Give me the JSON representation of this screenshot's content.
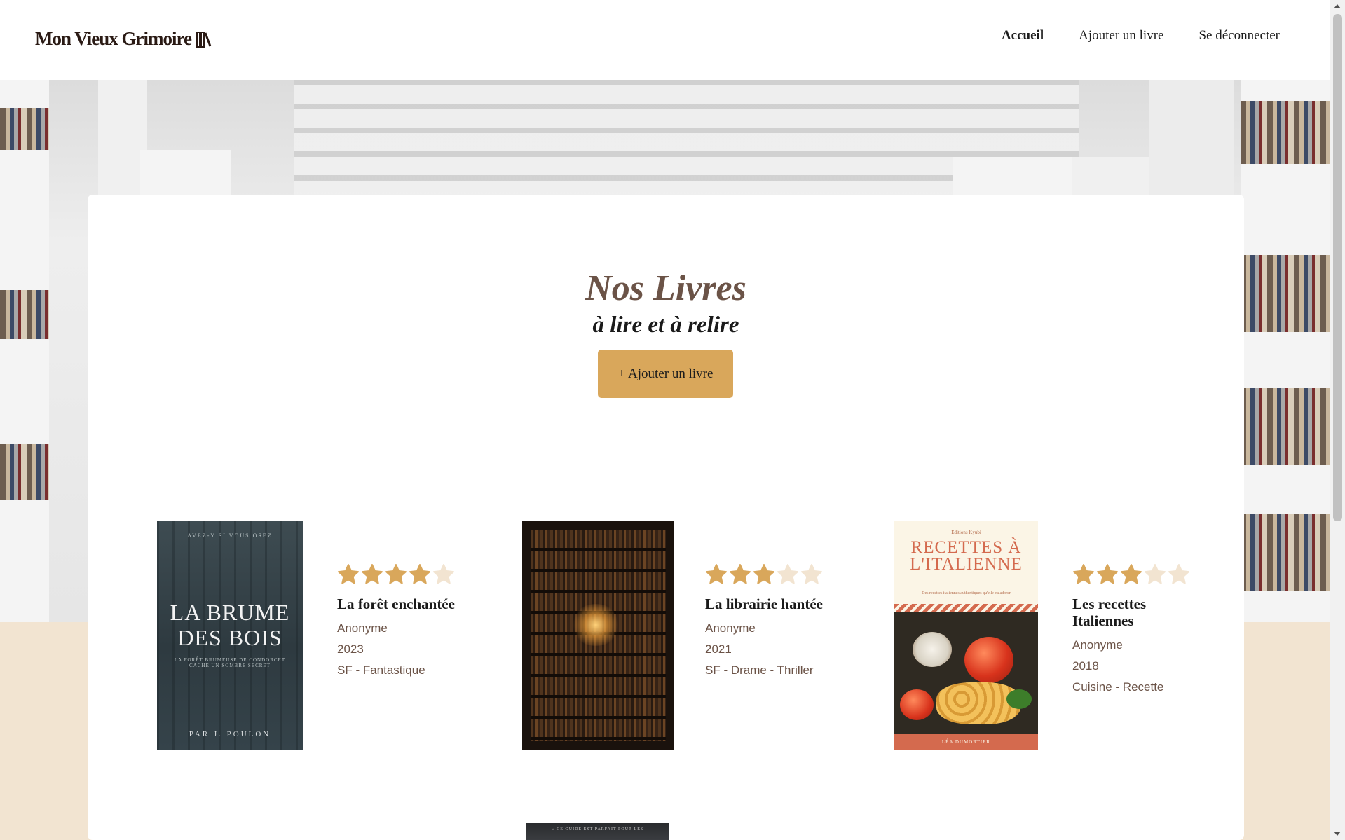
{
  "header": {
    "logo_text": "Mon Vieux Grimoire",
    "logo_icon": "books-icon",
    "nav": [
      {
        "label": "Accueil",
        "active": true
      },
      {
        "label": "Ajouter un livre",
        "active": false
      },
      {
        "label": "Se déconnecter",
        "active": false
      }
    ]
  },
  "main": {
    "title": "Nos Livres",
    "subtitle": "à lire et à relire",
    "add_button_label": "+ Ajouter un livre"
  },
  "books": [
    {
      "title": "La forêt enchantée",
      "author": "Anonyme",
      "year": "2023",
      "genre": "SF - Fantastique",
      "rating": 4,
      "cover": {
        "top": "AVEZ-Y SI VOUS OSEZ",
        "title": "LA BRUME DES BOIS",
        "tagline": "LA FORÊT BRUMEUSE DE CONDORCET CACHE UN SOMBRE SECRET",
        "author": "PAR J. POULON"
      }
    },
    {
      "title": "La librairie hantée",
      "author": "Anonyme",
      "year": "2021",
      "genre": "SF - Drame - Thriller",
      "rating": 3
    },
    {
      "title": "Les recettes Italiennes",
      "author": "Anonyme",
      "year": "2018",
      "genre": "Cuisine - Recette",
      "rating": 3,
      "cover": {
        "publisher": "Editions Kyubi",
        "title": "RECETTES À L'ITALIENNE",
        "tagline": "Des recettes italiennes authentiques qu'elle va adorer",
        "author": "LÉA DUMORTIER"
      }
    }
  ],
  "partial_book": {
    "cover_text": "« CE GUIDE EST PARFAIT POUR LES"
  },
  "colors": {
    "accent": "#d9a75b",
    "star_filled": "#d9a75b",
    "star_empty": "#f2e4d1",
    "brown_text": "#6b5347",
    "page_bg": "#f2e4d1"
  }
}
